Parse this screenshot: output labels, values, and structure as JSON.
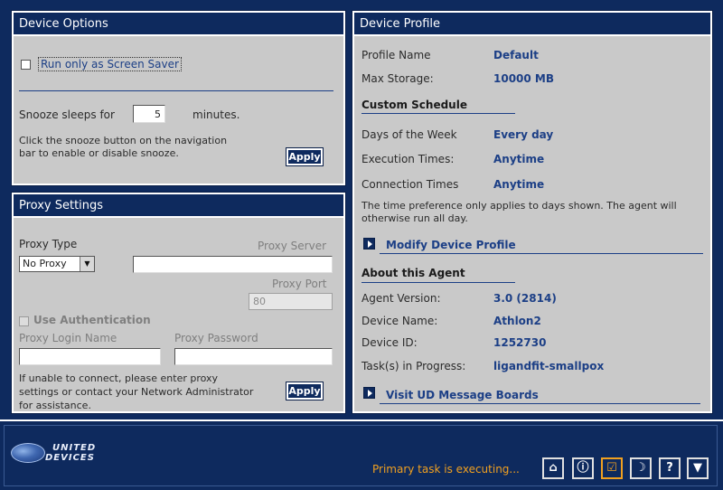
{
  "device_options": {
    "title": "Device Options",
    "screen_saver_label": "Run only as Screen Saver",
    "snooze_label": "Snooze sleeps for",
    "snooze_value": "5",
    "snooze_unit": "minutes.",
    "snooze_help_line1": "Click the snooze button on the navigation",
    "snooze_help_line2": "bar to enable or disable snooze.",
    "apply_label": "Apply"
  },
  "proxy": {
    "title": "Proxy Settings",
    "type_label": "Proxy Type",
    "type_value": "No Proxy",
    "server_label": "Proxy Server",
    "server_value": "",
    "port_label": "Proxy Port",
    "port_value": "80",
    "auth_label": "Use Authentication",
    "login_label": "Proxy Login Name",
    "login_value": "",
    "password_label": "Proxy Password",
    "password_value": "",
    "help_line1": "If unable to connect, please enter proxy",
    "help_line2": "settings or contact your Network Administrator",
    "help_line3": "for assistance.",
    "apply_label": "Apply"
  },
  "profile": {
    "title": "Device Profile",
    "profile_name_label": "Profile Name",
    "profile_name_value": "Default",
    "max_storage_label": "Max Storage:",
    "max_storage_value": "10000 MB",
    "custom_schedule_title": "Custom Schedule",
    "days_label": "Days of the Week",
    "days_value": "Every day",
    "exec_label": "Execution Times:",
    "exec_value": "Anytime",
    "conn_label": "Connection Times",
    "conn_value": "Anytime",
    "note_line1": "The time preference only applies to days shown. The agent will",
    "note_line2": "otherwise run all day.",
    "modify_link": "Modify Device Profile",
    "about_title": "About this Agent",
    "agent_version_label": "Agent Version:",
    "agent_version_value": "3.0 (2814)",
    "device_name_label": "Device Name:",
    "device_name_value": "Athlon2",
    "device_id_label": "Device ID:",
    "device_id_value": "1252730",
    "tasks_label": "Task(s) in Progress:",
    "tasks_value": "ligandfit-smallpox",
    "boards_link": "Visit UD Message Boards"
  },
  "footer": {
    "logo_line1": "UNITED",
    "logo_line2": "DEVICES",
    "status": "Primary task is executing..."
  },
  "colors": {
    "navy": "#0e2a5e",
    "panel": "#c9c9c9",
    "value_blue": "#1c3f86",
    "status_orange": "#f0a020"
  },
  "icons": {
    "toolbar": [
      "home-icon",
      "info-icon",
      "check-icon",
      "moon-icon",
      "help-icon",
      "chevron-down-icon"
    ]
  }
}
